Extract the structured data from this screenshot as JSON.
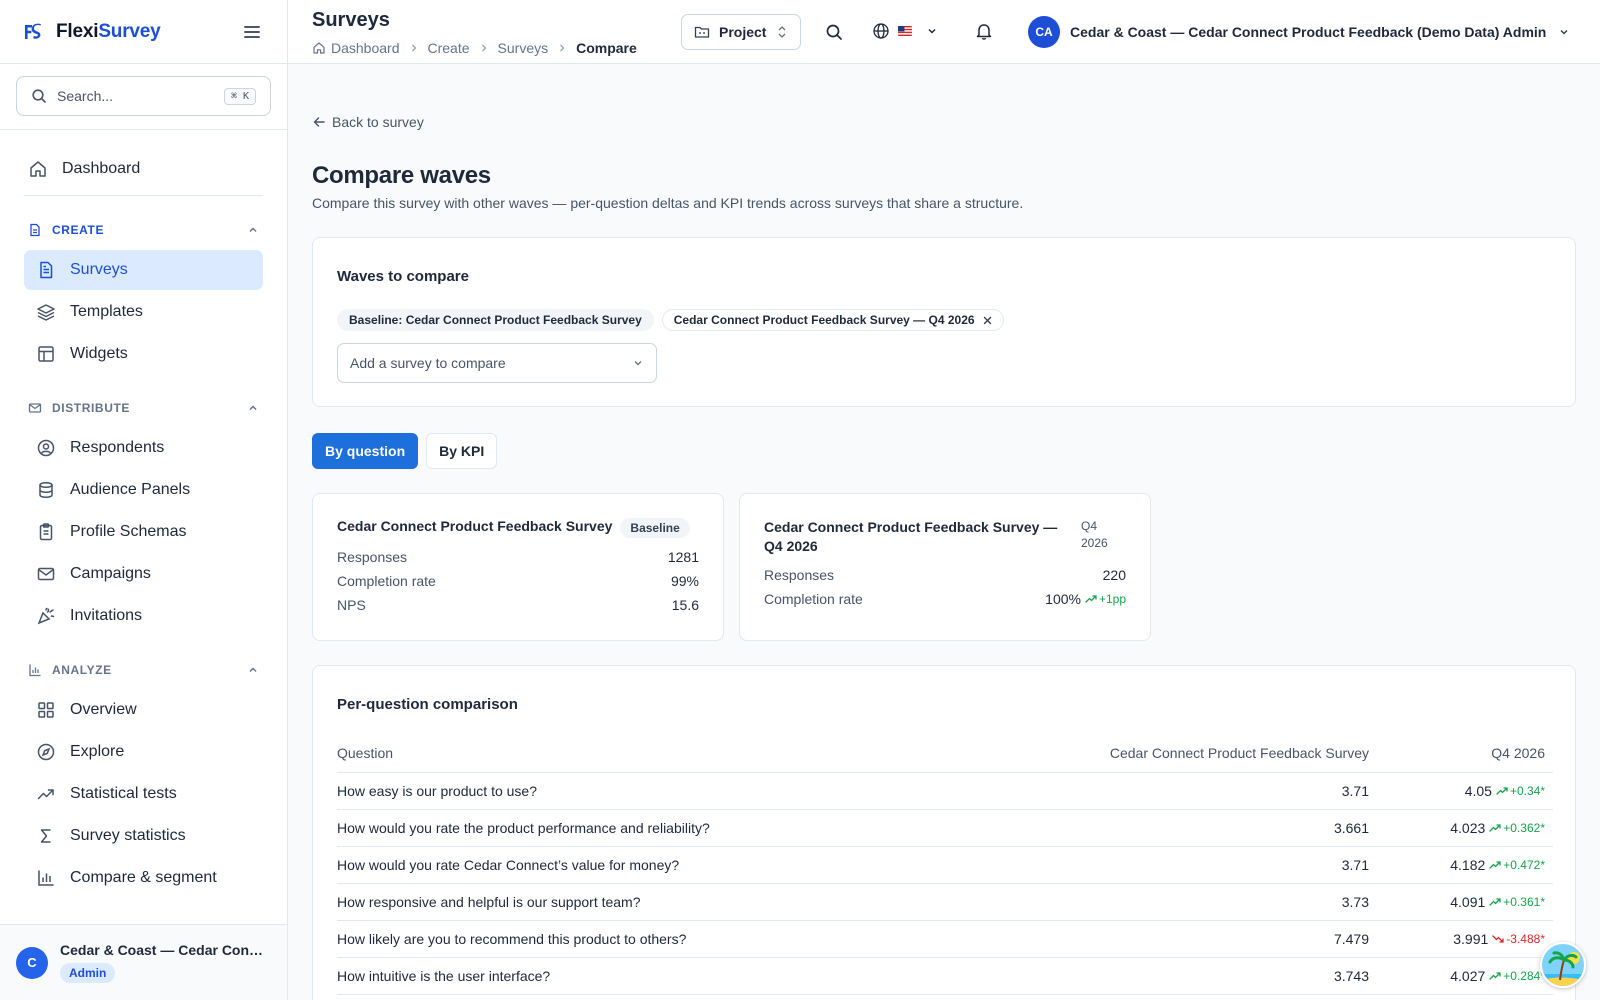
{
  "app": {
    "brand_prefix": "Flexi",
    "brand_suffix": "Survey"
  },
  "sidebar": {
    "search_placeholder": "Search...",
    "search_shortcut": "⌘ K",
    "dashboard": "Dashboard",
    "sections": [
      {
        "label": "CREATE",
        "items": [
          "Surveys",
          "Templates",
          "Widgets"
        ]
      },
      {
        "label": "DISTRIBUTE",
        "items": [
          "Respondents",
          "Audience Panels",
          "Profile Schemas",
          "Campaigns",
          "Invitations"
        ]
      },
      {
        "label": "ANALYZE",
        "items": [
          "Overview",
          "Explore",
          "Statistical tests",
          "Survey statistics",
          "Compare & segment"
        ]
      }
    ],
    "user": {
      "initial": "C",
      "name": "Cedar & Coast — Cedar Connect Product Feedback (Demo Data) Admin",
      "role": "Admin"
    }
  },
  "header": {
    "title": "Surveys",
    "breadcrumb": [
      "Dashboard",
      "Create",
      "Surveys",
      "Compare"
    ],
    "project_label": "Project",
    "user_initials": "CA",
    "user_name": "Cedar & Coast — Cedar Connect Product Feedback (Demo Data) Admin"
  },
  "page": {
    "back_label": "Back to survey",
    "title": "Compare waves",
    "subtitle": "Compare this survey with other waves — per-question deltas and KPI trends across surveys that share a structure."
  },
  "waves": {
    "title": "Waves to compare",
    "chips": [
      "Baseline: Cedar Connect Product Feedback Survey",
      "Cedar Connect Product Feedback Survey — Q4 2026"
    ],
    "add_placeholder": "Add a survey to compare"
  },
  "tabs": [
    "By question",
    "By KPI"
  ],
  "summary": [
    {
      "title": "Cedar Connect Product Feedback Survey",
      "badge": "Baseline",
      "stats": [
        {
          "label": "Responses",
          "value": "1281"
        },
        {
          "label": "Completion rate",
          "value": "99%"
        },
        {
          "label": "NPS",
          "value": "15.6"
        }
      ]
    },
    {
      "title": "Cedar Connect Product Feedback Survey — Q4 2026",
      "badge": "Q4 2026",
      "stats": [
        {
          "label": "Responses",
          "value": "220"
        },
        {
          "label": "Completion rate",
          "value": "100%",
          "delta": "+1pp",
          "trend": "up"
        }
      ]
    }
  ],
  "per_question": {
    "title": "Per-question comparison",
    "columns": [
      "Question",
      "Cedar Connect Product Feedback Survey",
      "Q4 2026"
    ],
    "rows": [
      {
        "question": "How easy is our product to use?",
        "baseline": "3.71",
        "wave": "4.05",
        "delta": "+0.34*",
        "trend": "up"
      },
      {
        "question": "How would you rate the product performance and reliability?",
        "baseline": "3.661",
        "wave": "4.023",
        "delta": "+0.362*",
        "trend": "up"
      },
      {
        "question": "How would you rate Cedar Connect’s value for money?",
        "baseline": "3.71",
        "wave": "4.182",
        "delta": "+0.472*",
        "trend": "up"
      },
      {
        "question": "How responsive and helpful is our support team?",
        "baseline": "3.73",
        "wave": "4.091",
        "delta": "+0.361*",
        "trend": "up"
      },
      {
        "question": "How likely are you to recommend this product to others?",
        "baseline": "7.479",
        "wave": "3.991",
        "delta": "-3.488*",
        "trend": "down"
      },
      {
        "question": "How intuitive is the user interface?",
        "baseline": "3.743",
        "wave": "4.027",
        "delta": "+0.284*",
        "trend": "up"
      }
    ]
  },
  "colors": {
    "primary": "#1d4ed8",
    "active_bg": "#dbeafe",
    "positive": "#16a34a",
    "negative": "#dc2626"
  }
}
